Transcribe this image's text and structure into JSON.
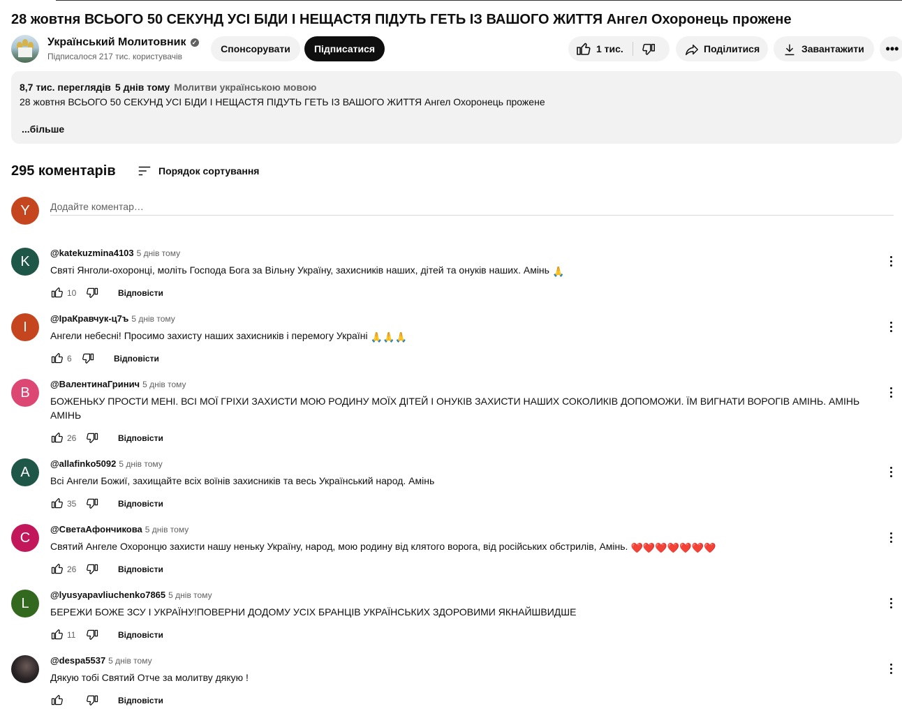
{
  "video": {
    "title": "28 жовтня ВСЬОГО 50 СЕКУНД УСІ БІДИ І НЕЩАСТЯ ПІДУТЬ ГЕТЬ ІЗ ВАШОГО ЖИТТЯ Ангел Охоронець прожене"
  },
  "channel": {
    "name": "Український Молитовник",
    "subscribers": "Підписалося 217 тис. користувачів",
    "sponsor_label": "Спонсорувати",
    "subscribe_label": "Підписатися"
  },
  "actions": {
    "likes": "1 тис.",
    "share_label": "Поділитися",
    "download_label": "Завантажити"
  },
  "description": {
    "views": "8,7 тис. переглядів",
    "date": "5 днів тому",
    "tag": "Молитви українською мовою",
    "text": "28 жовтня ВСЬОГО 50 СЕКУНД УСІ БІДИ І НЕЩАСТЯ ПІДУТЬ ГЕТЬ ІЗ ВАШОГО ЖИТТЯ Ангел Охоронець прожене",
    "more": "...більше"
  },
  "comments_section": {
    "count": "295 коментарів",
    "sort_label": "Порядок сортування",
    "add_placeholder": "Додайте коментар…",
    "user_initial": "Y",
    "user_color": "#c5461e",
    "reply_label": "Відповісти"
  },
  "comments": [
    {
      "initial": "K",
      "color": "#1e5648",
      "author": "@katekuzmina4103",
      "time": "5 днів тому",
      "text": "Святі Янголи-охоронці, моліть Господа Бога за Вільну Україну, захисників наших, дітей та онуків наших. Амінь",
      "emoji": "🙏",
      "likes": "10"
    },
    {
      "initial": "I",
      "color": "#c5461e",
      "author": "@ІраКравчук-ц7ъ",
      "time": "5 днів тому",
      "text": "Ангели небесні! Просимо захисту наших захисників і перемогу Україні",
      "emoji": "🙏🙏🙏",
      "likes": "6"
    },
    {
      "initial": "B",
      "color": "#dc4873",
      "author": "@ВалентинаГринич",
      "time": "5 днів тому",
      "text": "БОЖЕНЬКУ ПРОСТИ  МЕНІ. ВСІ  МОЇ ГРІХИ  ЗАХИСТИ МОЮ РОДИНУ   МОЇХ  ДІТЕЙ    І ОНУКІВ  ЗАХИСТИ НАШИХ СОКОЛИКІВ  ДОПОМОЖИ. ЇМ  ВИГНАТИ  ВОРОГІВ  АМІНЬ. АМІНЬ АМІНЬ",
      "emoji": "",
      "likes": "26"
    },
    {
      "initial": "A",
      "color": "#1e5648",
      "author": "@allafinko5092",
      "time": "5 днів тому",
      "text": "Всі Ангели Божиї, захищайте всіх воїнів захисників та весь Український народ. Амінь",
      "emoji": "",
      "likes": "35"
    },
    {
      "initial": "C",
      "color": "#c2185b",
      "author": "@СветаАфончикова",
      "time": "5 днів тому",
      "text": "Святий Ангеле Охоронцю захисти нашу неньку Україну, народ, мою родину від клятого ворога, від російських обстрилів, Амінь.",
      "emoji": "❤️❤️❤️❤️❤️❤️❤️",
      "likes": "26"
    },
    {
      "initial": "L",
      "color": "#33691e",
      "author": "@lyusyapavliuchenko7865",
      "time": "5 днів тому",
      "text": "БЕРЕЖИ БОЖЕ ЗСУ І УКРАЇНУ!ПОВЕРНИ ДОДОМУ УСІХ БРАНЦІВ УКРАЇНСЬКИХ ЗДОРОВИМИ ЯКНАЙШВИДШЕ",
      "emoji": "",
      "likes": "11"
    },
    {
      "initial": "",
      "color": "#2a2426",
      "author": "@despa5537",
      "time": "5 днів тому",
      "text": "Дякую тобі Святий Отче за молитву дякую !",
      "emoji": "",
      "likes": ""
    }
  ]
}
